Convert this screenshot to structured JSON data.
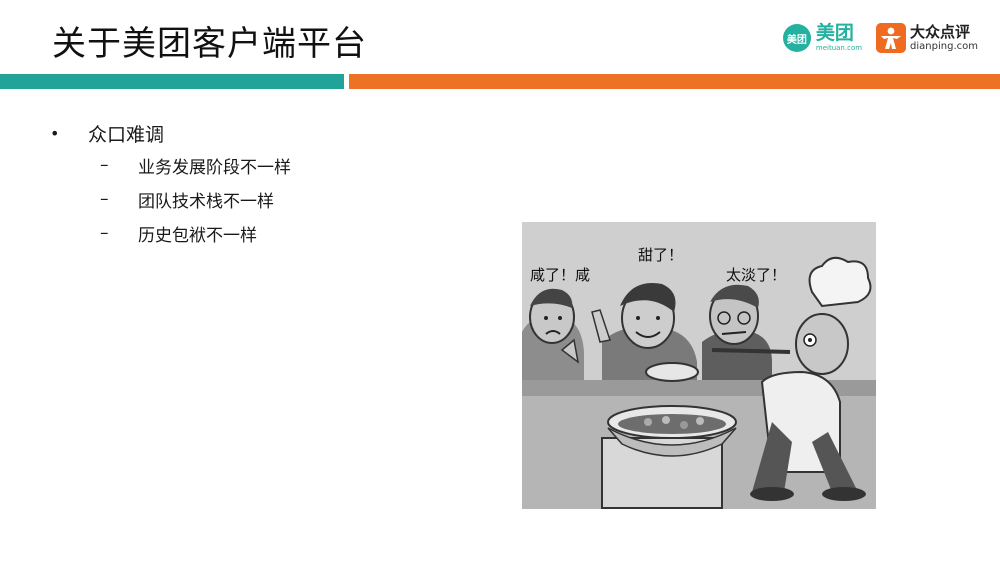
{
  "slide": {
    "title": "关于美团客户端平台"
  },
  "logos": {
    "meituan_badge": "美团",
    "meituan_name": "美团",
    "meituan_sub": "meituan.com",
    "dianping_name": "大众点评",
    "dianping_sub": "dianping.com"
  },
  "colors": {
    "teal": "#21a39a",
    "orange": "#ed7226",
    "meituan_green": "#25b19f"
  },
  "bullets": [
    {
      "text": "众口难调",
      "marker": "•",
      "sub": [
        {
          "marker": "–",
          "text": "业务发展阶段不一样"
        },
        {
          "marker": "–",
          "text": "团队技术栈不一样"
        },
        {
          "marker": "–",
          "text": "历史包袱不一样"
        }
      ]
    }
  ],
  "cartoon": {
    "speech_1": "咸了！咸",
    "speech_2": "甜了！",
    "speech_3": "太淡了！"
  }
}
